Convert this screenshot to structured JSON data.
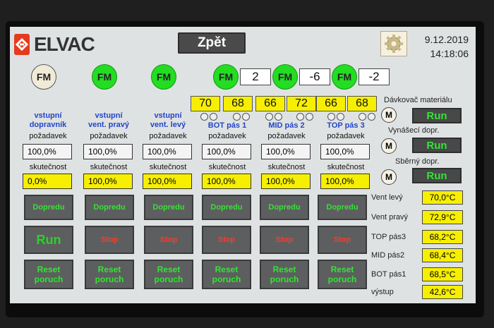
{
  "header": {
    "brand": "ELVAC",
    "back_label": "Zpět",
    "date": "9.12.2019",
    "time": "14:18:06",
    "gear_icon": "gear-icon"
  },
  "fm_label": "FM",
  "fm_row": [
    {
      "state": "off"
    },
    {
      "state": "on"
    },
    {
      "state": "on"
    },
    {
      "state": "on",
      "value": "2"
    },
    {
      "state": "on",
      "value": "-6"
    },
    {
      "state": "on",
      "value": "-2"
    }
  ],
  "yellow_pairs": [
    [
      "70",
      "68"
    ],
    [
      "66",
      "72"
    ],
    [
      "66",
      "68"
    ]
  ],
  "columns": [
    {
      "title1": "vstupní",
      "title2": "dopravník",
      "setpoint": "100,0%",
      "actual": "0,0%",
      "dir_label": "Dopredu",
      "state_label": "Run",
      "state": "run",
      "reset1": "Reset",
      "reset2": "poruch"
    },
    {
      "title1": "vstupní",
      "title2": "vent. pravý",
      "setpoint": "100,0%",
      "actual": "100,0%",
      "dir_label": "Dopredu",
      "state_label": "Stop",
      "state": "stop",
      "reset1": "Reset",
      "reset2": "poruch"
    },
    {
      "title1": "vstupní",
      "title2": "vent. levý",
      "setpoint": "100,0%",
      "actual": "100,0%",
      "dir_label": "Dopredu",
      "state_label": "Stop",
      "state": "stop",
      "reset1": "Reset",
      "reset2": "poruch"
    },
    {
      "title1": "BOT pás 1",
      "title2": "",
      "setpoint": "100,0%",
      "actual": "100,0%",
      "dir_label": "Dopredu",
      "state_label": "Stop",
      "state": "stop",
      "reset1": "Reset",
      "reset2": "poruch"
    },
    {
      "title1": "MID pás 2",
      "title2": "",
      "setpoint": "100,0%",
      "actual": "100,0%",
      "dir_label": "Dopredu",
      "state_label": "Stop",
      "state": "stop",
      "reset1": "Reset",
      "reset2": "poruch"
    },
    {
      "title1": "TOP pás 3",
      "title2": "",
      "setpoint": "100,0%",
      "actual": "100,0%",
      "dir_label": "Dopredu",
      "state_label": "Stop",
      "state": "stop",
      "reset1": "Reset",
      "reset2": "poruch"
    }
  ],
  "labels": {
    "setpoint": "požadavek",
    "actual": "skutečnost"
  },
  "machines": [
    {
      "name": "Dávkovač materiálu",
      "m_label": "M",
      "status": "Run"
    },
    {
      "name": "Vynášecí dopr.",
      "m_label": "M",
      "status": "Run"
    },
    {
      "name": "Sběrný dopr.",
      "m_label": "M",
      "status": "Run"
    }
  ],
  "temperatures": [
    {
      "label": "Vent levý",
      "value": "70,0°C"
    },
    {
      "label": "Vent pravý",
      "value": "72,9°C"
    },
    {
      "label": "TOP pás3",
      "value": "68,2°C"
    },
    {
      "label": "MID pás2",
      "value": "68,4°C"
    },
    {
      "label": "BOT pás1",
      "value": "68,5°C"
    },
    {
      "label": "výstup",
      "value": "42,6°C"
    }
  ]
}
